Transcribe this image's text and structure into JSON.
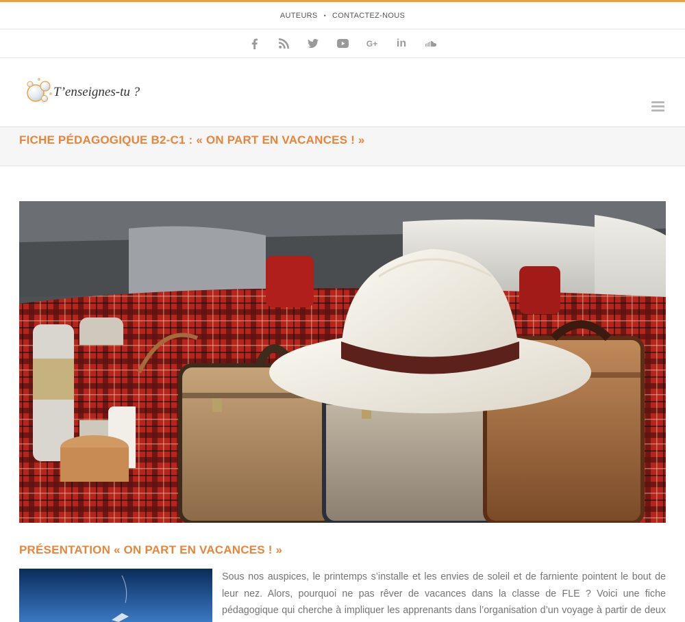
{
  "top_nav": {
    "links": [
      "AUTEURS",
      "CONTACTEZ-NOUS"
    ],
    "separator": "•"
  },
  "social": {
    "icons": [
      "facebook-icon",
      "rss-icon",
      "twitter-icon",
      "youtube-icon",
      "google-plus-icon",
      "linkedin-icon",
      "soundcloud-icon"
    ],
    "google_plus_label": "G+",
    "linkedin_label": "in"
  },
  "header": {
    "logo_text": "T’enseignes-tu ?"
  },
  "page": {
    "title": "FICHE PÉDAGOGIQUE B2-C1 : « ON PART EN VACANCES ! »"
  },
  "article": {
    "hero_alt": "Valises vintage, chapeau de paille et thermos dans le coffre d'une voiture",
    "section_title": "PRÉSENTATION « ON PART EN VACANCES ! »",
    "intro_text": "Sous nos auspices, le printemps s’installe et les envies de soleil et de farniente pointent le bout de leur nez. Alors, pourquoi ne pas rêver de vacances dans la classe de FLE ? Voici une fiche pédagogique qui cherche à impliquer les apprenants dans l’organisation d’un voyage à partir de deux points de vue :"
  },
  "colors": {
    "accent": "#e8853a",
    "top_border": "#e8a33a",
    "text": "#747474"
  }
}
